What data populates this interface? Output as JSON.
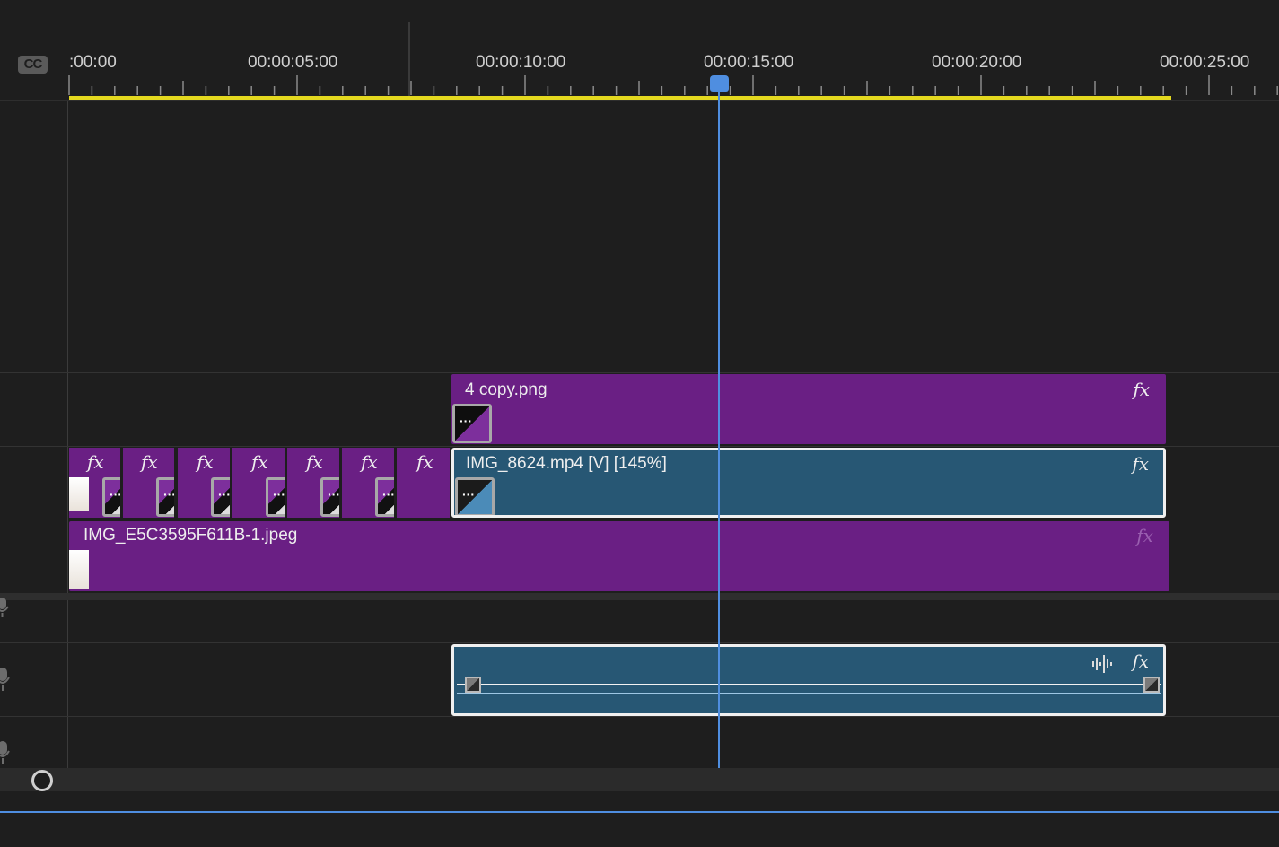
{
  "ruler": {
    "cc_button": "CC",
    "timecodes": [
      ":00:00",
      "00:00:05:00",
      "00:00:10:00",
      "00:00:15:00",
      "00:00:20:00",
      "00:00:25:00"
    ]
  },
  "tracks": {
    "v3_clip": {
      "label": "4 copy.png",
      "fx": "fx"
    },
    "v2_clip": {
      "label": "IMG_8624.mp4 [V] [145%]",
      "fx": "fx"
    },
    "v2_transition_fx": [
      "fx",
      "fx",
      "fx",
      "fx",
      "fx",
      "fx",
      "fx"
    ],
    "v1_clip": {
      "label": "IMG_E5C3595F611B-1.jpeg",
      "fx": "fx"
    },
    "a2_clip": {
      "fx": "fx"
    }
  },
  "icons": {
    "mic": "microphone-icon",
    "waveform": "audio-waveform-icon",
    "transition": "transition-icon"
  },
  "colors": {
    "video_clip": "#6a1f84",
    "selected_clip": "#275774",
    "playhead": "#4f8ee0",
    "work_area": "#e4d91f"
  }
}
